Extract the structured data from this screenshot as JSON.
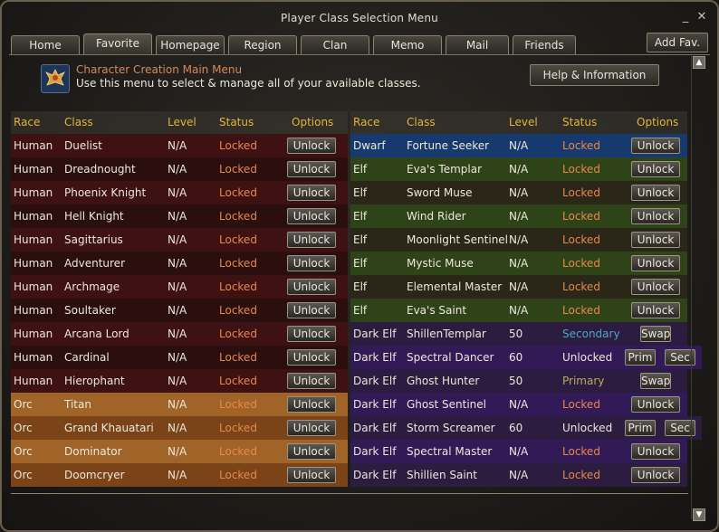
{
  "window": {
    "title": "Player Class Selection Menu",
    "minimize_glyph": "_",
    "close_glyph": "✕"
  },
  "tabs": [
    {
      "label": "Home"
    },
    {
      "label": "Favorite"
    },
    {
      "label": "Homepage"
    },
    {
      "label": "Region"
    },
    {
      "label": "Clan"
    },
    {
      "label": "Memo"
    },
    {
      "label": "Mail"
    },
    {
      "label": "Friends"
    }
  ],
  "active_tab": "Favorite",
  "add_fav_label": "Add Fav.",
  "header": {
    "icon": "phoenix-crest-icon",
    "title": "Character Creation Main Menu",
    "description": "Use this menu to select & manage all of your available classes.",
    "help_label": "Help & Information"
  },
  "scroll": {
    "up_glyph": "▲",
    "down_glyph": "▼"
  },
  "columns": {
    "race": "Race",
    "class": "Class",
    "level": "Level",
    "status": "Status",
    "options": "Options"
  },
  "colors": {
    "header_text": "#e4b43c",
    "locked": "#e8884a",
    "secondary": "#4aa6c8",
    "primary": "#b8ac5a",
    "human_row": "#3e1212",
    "orc_row": "#a06428",
    "dwarf_row": "#163a6e",
    "elf_row": "#2e4418",
    "dark_elf_row": "#2c1c40"
  },
  "left_table": [
    {
      "race": "Human",
      "class": "Duelist",
      "level": "N/A",
      "status": "Locked",
      "options": [
        "Unlock"
      ]
    },
    {
      "race": "Human",
      "class": "Dreadnought",
      "level": "N/A",
      "status": "Locked",
      "options": [
        "Unlock"
      ]
    },
    {
      "race": "Human",
      "class": "Phoenix Knight",
      "level": "N/A",
      "status": "Locked",
      "options": [
        "Unlock"
      ]
    },
    {
      "race": "Human",
      "class": "Hell Knight",
      "level": "N/A",
      "status": "Locked",
      "options": [
        "Unlock"
      ]
    },
    {
      "race": "Human",
      "class": "Sagittarius",
      "level": "N/A",
      "status": "Locked",
      "options": [
        "Unlock"
      ]
    },
    {
      "race": "Human",
      "class": "Adventurer",
      "level": "N/A",
      "status": "Locked",
      "options": [
        "Unlock"
      ]
    },
    {
      "race": "Human",
      "class": "Archmage",
      "level": "N/A",
      "status": "Locked",
      "options": [
        "Unlock"
      ]
    },
    {
      "race": "Human",
      "class": "Soultaker",
      "level": "N/A",
      "status": "Locked",
      "options": [
        "Unlock"
      ]
    },
    {
      "race": "Human",
      "class": "Arcana Lord",
      "level": "N/A",
      "status": "Locked",
      "options": [
        "Unlock"
      ]
    },
    {
      "race": "Human",
      "class": "Cardinal",
      "level": "N/A",
      "status": "Locked",
      "options": [
        "Unlock"
      ]
    },
    {
      "race": "Human",
      "class": "Hierophant",
      "level": "N/A",
      "status": "Locked",
      "options": [
        "Unlock"
      ]
    },
    {
      "race": "Orc",
      "class": "Titan",
      "level": "N/A",
      "status": "Locked",
      "options": [
        "Unlock"
      ]
    },
    {
      "race": "Orc",
      "class": "Grand Khauatari",
      "level": "N/A",
      "status": "Locked",
      "options": [
        "Unlock"
      ]
    },
    {
      "race": "Orc",
      "class": "Dominator",
      "level": "N/A",
      "status": "Locked",
      "options": [
        "Unlock"
      ]
    },
    {
      "race": "Orc",
      "class": "Doomcryer",
      "level": "N/A",
      "status": "Locked",
      "options": [
        "Unlock"
      ]
    }
  ],
  "right_table": [
    {
      "race": "Dwarf",
      "class": "Fortune Seeker",
      "level": "N/A",
      "status": "Locked",
      "options": [
        "Unlock"
      ]
    },
    {
      "race": "Elf",
      "class": "Eva's Templar",
      "level": "N/A",
      "status": "Locked",
      "options": [
        "Unlock"
      ]
    },
    {
      "race": "Elf",
      "class": "Sword Muse",
      "level": "N/A",
      "status": "Locked",
      "options": [
        "Unlock"
      ]
    },
    {
      "race": "Elf",
      "class": "Wind Rider",
      "level": "N/A",
      "status": "Locked",
      "options": [
        "Unlock"
      ]
    },
    {
      "race": "Elf",
      "class": "Moonlight Sentinel",
      "level": "N/A",
      "status": "Locked",
      "options": [
        "Unlock"
      ]
    },
    {
      "race": "Elf",
      "class": "Mystic Muse",
      "level": "N/A",
      "status": "Locked",
      "options": [
        "Unlock"
      ]
    },
    {
      "race": "Elf",
      "class": "Elemental Master",
      "level": "N/A",
      "status": "Locked",
      "options": [
        "Unlock"
      ]
    },
    {
      "race": "Elf",
      "class": "Eva's Saint",
      "level": "N/A",
      "status": "Locked",
      "options": [
        "Unlock"
      ]
    },
    {
      "race": "Dark Elf",
      "class": "ShillenTemplar",
      "level": "50",
      "status": "Secondary",
      "options": [
        "Swap"
      ]
    },
    {
      "race": "Dark Elf",
      "class": "Spectral Dancer",
      "level": "60",
      "status": "Unlocked",
      "options": [
        "Prim",
        "Sec"
      ]
    },
    {
      "race": "Dark Elf",
      "class": "Ghost Hunter",
      "level": "50",
      "status": "Primary",
      "options": [
        "Swap"
      ]
    },
    {
      "race": "Dark Elf",
      "class": "Ghost Sentinel",
      "level": "N/A",
      "status": "Locked",
      "options": [
        "Unlock"
      ]
    },
    {
      "race": "Dark Elf",
      "class": "Storm Screamer",
      "level": "60",
      "status": "Unlocked",
      "options": [
        "Prim",
        "Sec"
      ]
    },
    {
      "race": "Dark Elf",
      "class": "Spectral Master",
      "level": "N/A",
      "status": "Locked",
      "options": [
        "Unlock"
      ]
    },
    {
      "race": "Dark Elf",
      "class": "Shillien Saint",
      "level": "N/A",
      "status": "Locked",
      "options": [
        "Unlock"
      ]
    }
  ]
}
